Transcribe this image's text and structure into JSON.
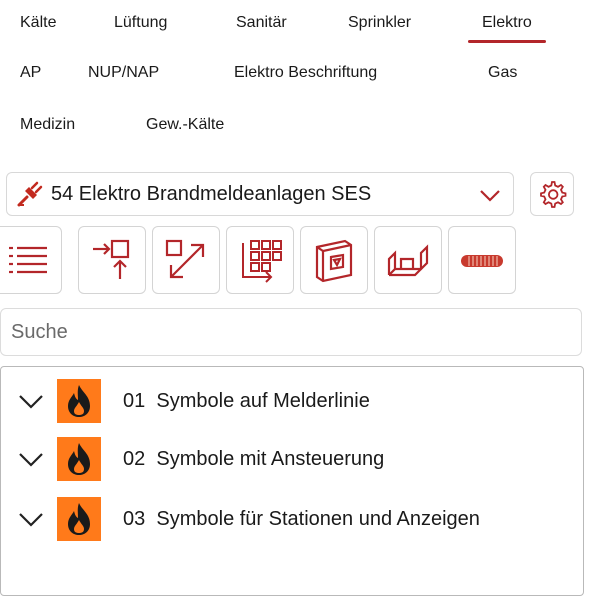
{
  "tabs": [
    {
      "label": "Kälte",
      "active": false
    },
    {
      "label": "Lüftung",
      "active": false
    },
    {
      "label": "Sanitär",
      "active": false
    },
    {
      "label": "Sprinkler",
      "active": false
    },
    {
      "label": "Elektro",
      "active": true
    },
    {
      "label": "AP",
      "active": false
    },
    {
      "label": "NUP/NAP",
      "active": false
    },
    {
      "label": "Elektro Beschriftung",
      "active": false
    },
    {
      "label": "Gas",
      "active": false
    },
    {
      "label": "Medizin",
      "active": false
    },
    {
      "label": "Gew.-Kälte",
      "active": false
    }
  ],
  "accent_color": "#b3262a",
  "category_dropdown": {
    "selected": "54  Elektro Brandmeldeanlagen SES",
    "icon": "plug-icon"
  },
  "toolbar": {
    "buttons": [
      {
        "icon": "list-icon"
      },
      {
        "icon": "insert-upwards-icon"
      },
      {
        "icon": "diagonal-arrows-icon"
      },
      {
        "icon": "grid-export-icon"
      },
      {
        "icon": "wall-box-icon"
      },
      {
        "icon": "floor-box-icon"
      },
      {
        "icon": "cable-coil-icon"
      }
    ]
  },
  "search": {
    "placeholder": "Suche",
    "value": ""
  },
  "tree": {
    "items": [
      {
        "number": "01",
        "label": "Symbole auf Melderlinie"
      },
      {
        "number": "02",
        "label": "Symbole mit Ansteuerung"
      },
      {
        "number": "03",
        "label": "Symbole für Stationen und Anzeigen"
      }
    ],
    "icon_color": "#ff7a1a"
  }
}
